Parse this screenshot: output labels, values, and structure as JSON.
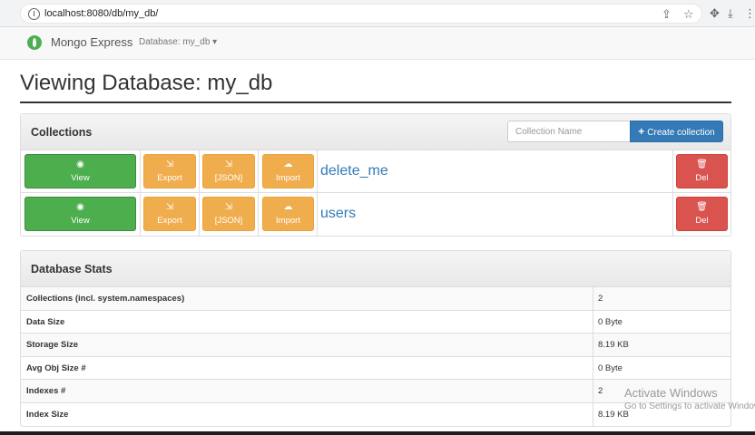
{
  "browser": {
    "url": "localhost:8080/db/my_db/",
    "icons": [
      "info-icon",
      "share-icon",
      "star-icon",
      "extensions-icon",
      "download-icon",
      "menu-icon"
    ]
  },
  "navbar": {
    "brand": "Mongo Express",
    "database_label": "Database: my_db"
  },
  "page": {
    "title": "Viewing Database: my_db"
  },
  "collections": {
    "heading": "Collections",
    "input_placeholder": "Collection Name",
    "create_label": "Create collection",
    "row_buttons": {
      "view": "View",
      "export": "Export",
      "json": "[JSON]",
      "import": "Import",
      "delete": "Del"
    },
    "items": [
      {
        "name": "delete_me"
      },
      {
        "name": "users"
      }
    ]
  },
  "stats": {
    "heading": "Database Stats",
    "rows": [
      {
        "label": "Collections (incl. system.namespaces)",
        "value": "2"
      },
      {
        "label": "Data Size",
        "value": "0 Byte"
      },
      {
        "label": "Storage Size",
        "value": "8.19 KB"
      },
      {
        "label": "Avg Obj Size #",
        "value": "0 Byte"
      },
      {
        "label": "Indexes #",
        "value": "2"
      },
      {
        "label": "Index Size",
        "value": "8.19 KB"
      }
    ]
  },
  "watermark": {
    "line1": "Activate Windows",
    "line2": "Go to Settings to activate Windows."
  },
  "colors": {
    "primary": "#337ab7",
    "success": "#4cae4c",
    "warning": "#f0ad4e",
    "danger": "#d9534f"
  }
}
